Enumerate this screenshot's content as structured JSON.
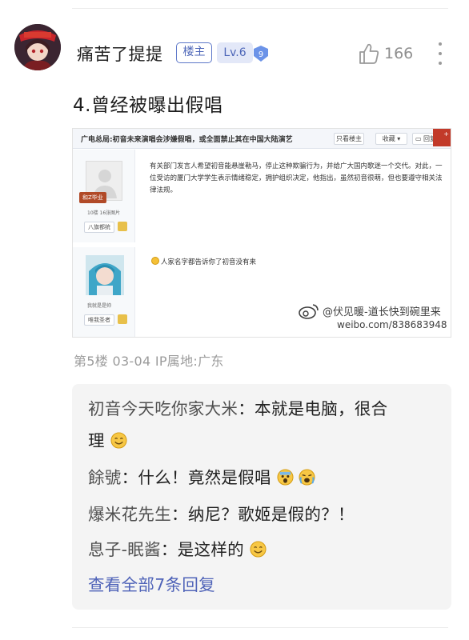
{
  "post": {
    "username": "痛苦了提提",
    "op_badge": "楼主",
    "level_badge": "Lv.6",
    "vip_level": "9",
    "like_count": "166",
    "text": "4.曾经被曝出假唱",
    "floor_meta": "第5楼  03-04  IP属地:广东"
  },
  "embedded": {
    "title": "广电总局:初音未来演唱会涉嫌假唱，或全面禁止其在中国大陆演艺",
    "btn_op_only": "只看楼主",
    "btn_favorite": "收藏",
    "btn_reply": "回复",
    "corner_label": "+",
    "user1_tag": "和Z毕业",
    "user1_info": "10楼 16张图片",
    "user1_pill": "八旗都统",
    "user2_name": "我就是是帅",
    "user2_pill": "唯我圣者",
    "body": "有关部门发言人希望初音能悬崖勒马，停止这种欺骗行为，并给广大国内歌迷一个交代。对此，一位受访的厦门大学学生表示情绪稳定，拥护组织决定，他指出，虽然初音很萌，但也要遵守相关法律法规。",
    "reply_text": "人家名字都告诉你了初音没有来",
    "watermark_line1": "@伏见暖-道长快到碗里来",
    "watermark_line2": "weibo.com/838683948"
  },
  "replies": [
    {
      "name": "初音今天吃你家大米",
      "text": "本就是电脑，很合",
      "text2": "理",
      "emoji": "smile-emoji"
    },
    {
      "name": "餘號",
      "text": "什么！竟然是假唱",
      "emoji": "scream-emoji"
    },
    {
      "name": "爆米花先生",
      "text": "纳尼？歌姬是假的？！"
    },
    {
      "name": "息子-眠酱",
      "text": "是这样的",
      "emoji": "smile-emoji"
    }
  ],
  "view_all": "查看全部7条回复",
  "colors": {
    "accent": "#4f63b8",
    "meta_gray": "#9b9b9b",
    "reply_bg": "#f4f4f4"
  }
}
